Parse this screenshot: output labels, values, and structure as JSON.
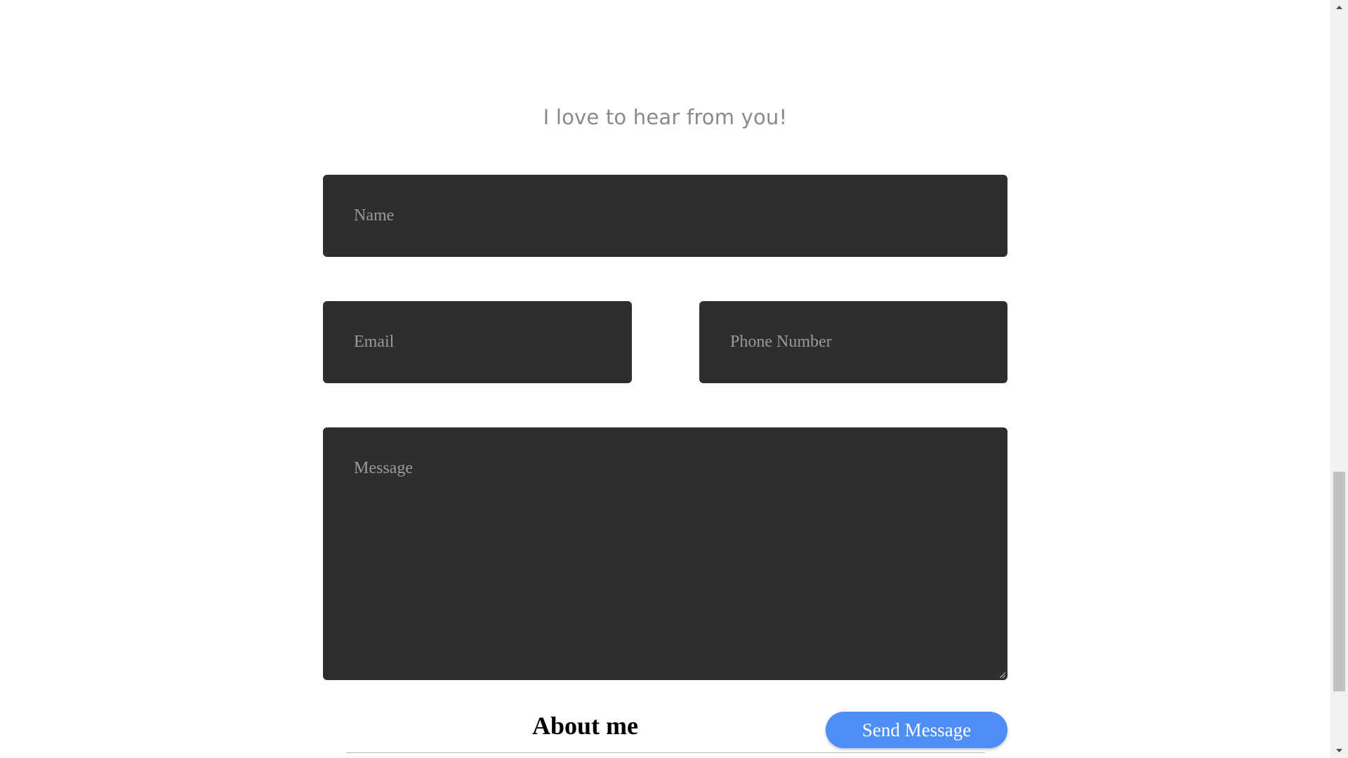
{
  "contact": {
    "subtitle": "I love to hear from you!",
    "name_placeholder": "Name",
    "email_placeholder": "Email",
    "phone_placeholder": "Phone Number",
    "message_placeholder": "Message",
    "send_label": "Send Message"
  },
  "about": {
    "title": "About me"
  },
  "colors": {
    "field_background": "#2e2e2e",
    "placeholder_text": "#9a9a9a",
    "accent_button": "#4d8ef7",
    "subtitle_text": "#8a8a8a"
  },
  "icons": {
    "resize_grip": "resize-grip-icon",
    "scroll_up": "chevron-up-icon",
    "scroll_down": "chevron-down-icon"
  }
}
